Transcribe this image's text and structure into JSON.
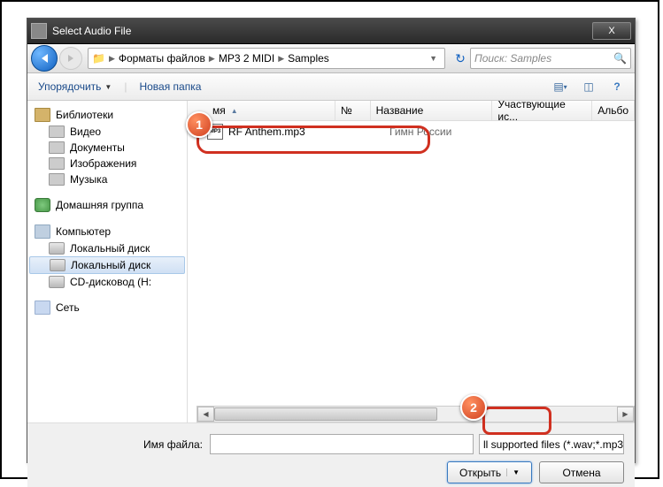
{
  "window": {
    "title": "Select Audio File",
    "close": "X"
  },
  "breadcrumb": {
    "p1": "Форматы файлов",
    "p2": "MP3 2 MIDI",
    "p3": "Samples"
  },
  "search": {
    "placeholder": "Поиск: Samples"
  },
  "toolbar": {
    "organize": "Упорядочить",
    "newfolder": "Новая папка"
  },
  "sidebar": {
    "libraries": "Библиотеки",
    "libs": {
      "video": "Видео",
      "docs": "Документы",
      "images": "Изображения",
      "music": "Музыка"
    },
    "homegroup": "Домашняя группа",
    "computer": "Компьютер",
    "drives": {
      "d1": "Локальный диск",
      "d2": "Локальный диск",
      "d3": "CD-дисковод (H:"
    },
    "network": "Сеть"
  },
  "columns": {
    "name": "мя",
    "num": "№",
    "title": "Название",
    "artists": "Участвующие ис...",
    "album": "Альбо"
  },
  "file": {
    "name": "RF Anthem.mp3",
    "title": "Гимн России",
    "icon": "MP3"
  },
  "bottom": {
    "filename_label": "Имя файла:",
    "filter": "ll supported files (*.wav;*.mp3",
    "open": "Открыть",
    "cancel": "Отмена"
  },
  "badges": {
    "b1": "1",
    "b2": "2"
  }
}
